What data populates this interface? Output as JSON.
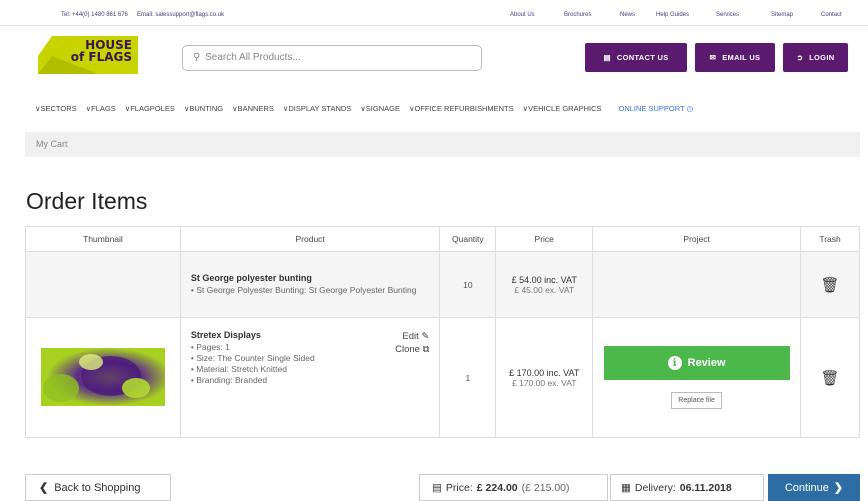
{
  "topbar": {
    "tel": "Tel: +44(0) 1480 861 676",
    "email": "Email: salessupport@flags.co.uk",
    "links": [
      "About Us",
      "Brochures",
      "News",
      "Help Guides",
      "Services",
      "Sitemap",
      "Contact"
    ]
  },
  "logo": {
    "line1": "HOUSE",
    "line2": "of FLAGS"
  },
  "search": {
    "placeholder": "Search All Products..."
  },
  "buttons": {
    "contact": "CONTACT US",
    "email": "EMAIL US",
    "login": "LOGIN"
  },
  "nav": [
    "SECTORS",
    "FLAGS",
    "FLAGPOLES",
    "BUNTING",
    "BANNERS",
    "DISPLAY STANDS",
    "SIGNAGE",
    "OFFICE REFURBISHMENTS",
    "VEHICLE GRAPHICS"
  ],
  "nav_support": "ONLINE SUPPORT",
  "breadcrumb": "My Cart",
  "title": "Order Items",
  "table": {
    "headers": [
      "Thumbnail",
      "Product",
      "Quantity",
      "Price",
      "Project",
      "Trash"
    ],
    "rows": [
      {
        "name": "St George polyester bunting",
        "details": [
          "St George Polyester Bunting: St George Polyester Bunting"
        ],
        "qty": "10",
        "price_inc": "£ 54.00 inc. VAT",
        "price_ex": "£ 45.00 ex. VAT"
      },
      {
        "name": "Stretex Displays",
        "details": [
          "Pages: 1",
          "Size: The Counter Single Sided",
          "Material: Stretch Knitted",
          "Branding: Branded"
        ],
        "edit": "Edit",
        "clone": "Clone",
        "qty": "1",
        "price_inc": "£ 170.00 inc. VAT",
        "price_ex": "£ 170.00 ex. VAT",
        "review": "Review",
        "replace": "Replace file"
      }
    ]
  },
  "footer": {
    "back": "Back to Shopping",
    "price_label": "Price:",
    "price_value": "£ 224.00",
    "price_ex": "(£ 215.00)",
    "delivery_label": "Delivery:",
    "delivery_value": "06.11.2018",
    "continue": "Continue"
  },
  "colors": {
    "brand_purple": "#5a1a6e",
    "logo_green": "#c8d400",
    "review_green": "#4cb84a",
    "continue_blue": "#2e6da4"
  }
}
